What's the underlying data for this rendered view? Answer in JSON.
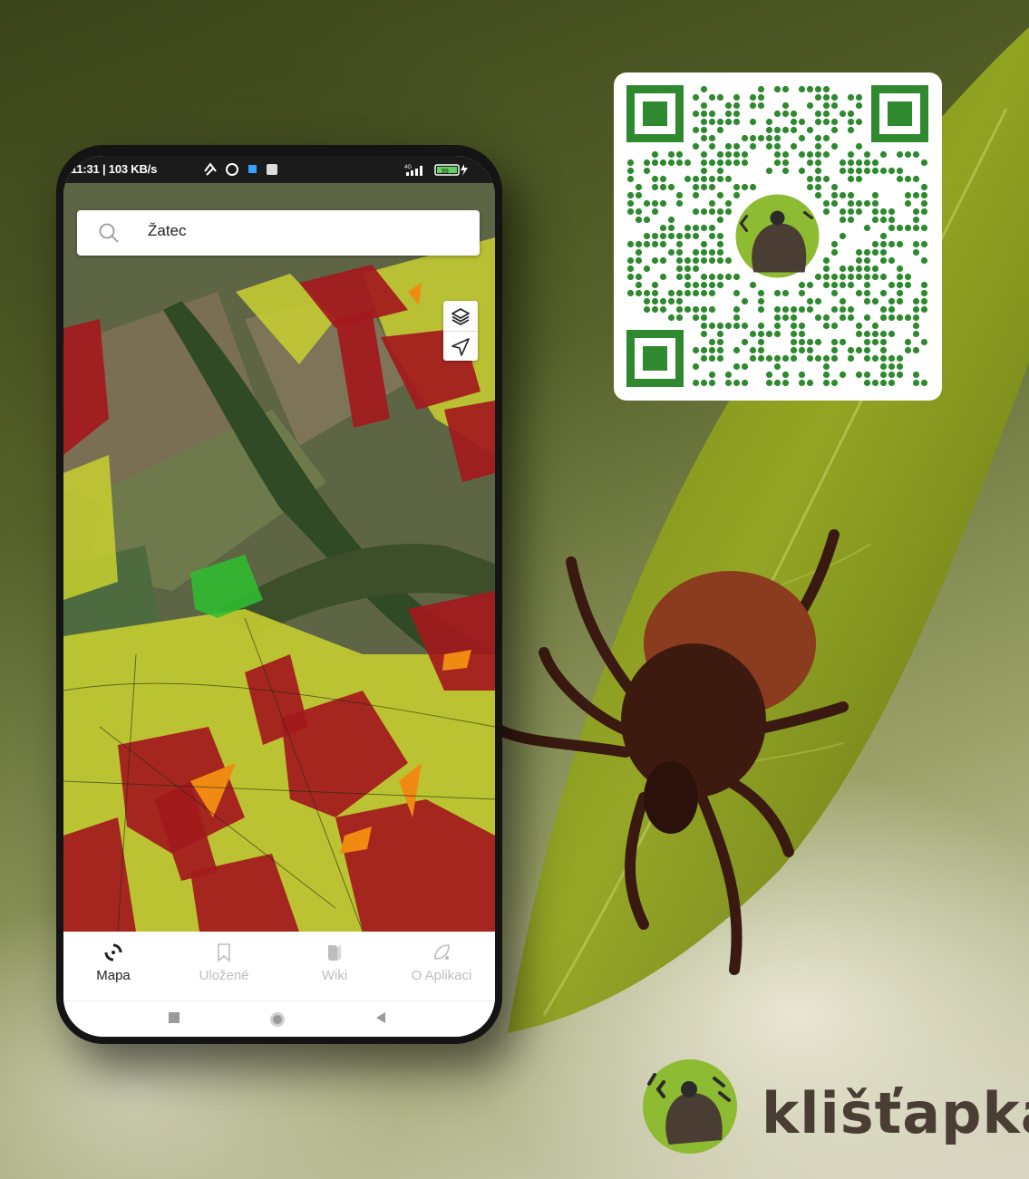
{
  "status_bar": {
    "time_speed": "11:31 | 103 KB/s",
    "network": "4G",
    "battery": "99"
  },
  "search": {
    "value": "Žatec"
  },
  "bottom_nav": [
    {
      "label": "Mapa",
      "active": true,
      "icon": "map-spinner-icon"
    },
    {
      "label": "Uložené",
      "active": false,
      "icon": "bookmark-icon"
    },
    {
      "label": "Wiki",
      "active": false,
      "icon": "book-icon"
    },
    {
      "label": "O Aplikaci",
      "active": false,
      "icon": "info-leaf-icon"
    }
  ],
  "map_tools": [
    "layers-icon",
    "locate-arrow-icon"
  ],
  "brand": {
    "name": "klišťapka"
  },
  "colors": {
    "risk_high": "#a3191d",
    "risk_medium": "#f08a12",
    "risk_low": "#c9d030",
    "risk_none": "#2fbf2f",
    "qr_green": "#2f8a2f",
    "brand_brown": "#4a3d33",
    "brand_green": "#8dbb32"
  }
}
